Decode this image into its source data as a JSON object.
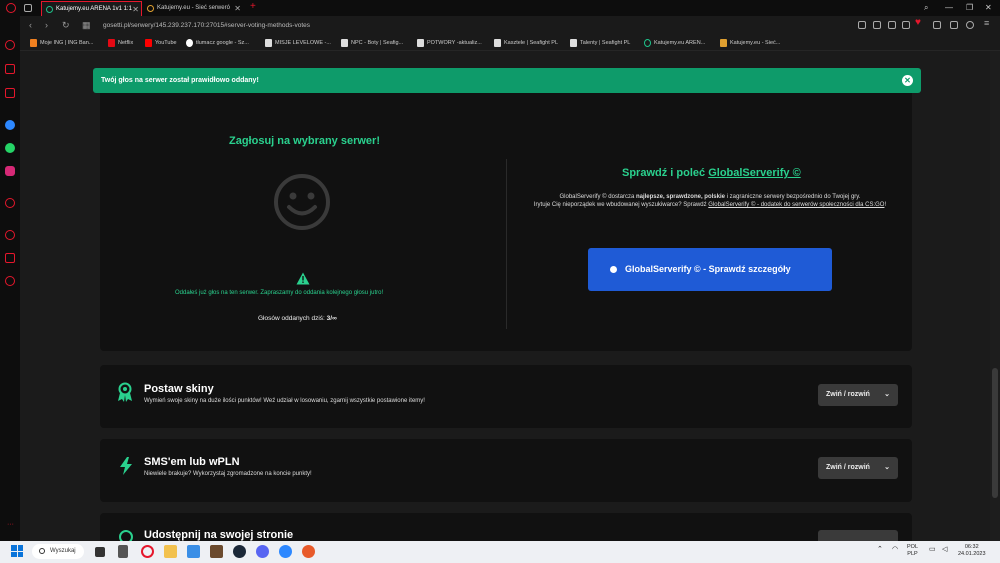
{
  "browser": {
    "tabs": [
      {
        "label": "Katujemy.eu ARENA 1v1 1:1",
        "active": true
      },
      {
        "label": "Katujemy.eu - Sieć serweró",
        "active": false
      }
    ],
    "url": "gosetti.pl/serwery/145.239.237.170:27015#server-voting-methods-votes",
    "bookmarks": [
      "Moje ING | ING Ban...",
      "Netflix",
      "YouTube",
      "tłumacz google - Sz...",
      "MISJE LEVELOWE -...",
      "NPC - Boty | Seafig...",
      "POTWORY -aktualiz...",
      "Kasztele | Seafight PL",
      "Talenty | Seafight PL",
      "Katujemy.eu AREN...",
      "Katujemy.eu - Sieć..."
    ]
  },
  "alert": {
    "message": "Twój głos na serwer został prawidłowo oddany!",
    "close_icon": "close-icon",
    "color": "#0e9b6a"
  },
  "vote_card": {
    "title": "Zagłosuj na wybrany serwer!",
    "smiley_icon": "smiley-icon",
    "warning_icon": "warning-icon",
    "voted_message": "Oddałeś już głos na ten serwer. Zapraszamy do oddania kolejnego głosu jutro!",
    "votes_label": "Głosów oddanych dziś:",
    "votes_value": "3/∞",
    "gs_title_prefix": "Sprawdź i poleć",
    "gs_title_link": "GlobalServerify ©",
    "gs_desc_1": "GlobalServerify © dostarcza ",
    "gs_desc_bold": "najlepsze, sprawdzone, polskie",
    "gs_desc_2": " i zagraniczne serwery bezpośrednio do Twojej gry.",
    "gs_desc_3": "Irytuje Cię nieporządek we wbudowanej wyszukiwarce? Sprawdź ",
    "gs_desc_link": "GlobalServerify © - dodatek do serwerów społeczności dla CS:GO",
    "gs_desc_end": "!",
    "gs_button": "GlobalServerify © - Sprawdź szczegóły",
    "accent": "#2ad18e",
    "button_color": "#1f5bd6"
  },
  "sections": [
    {
      "title": "Postaw skiny",
      "desc": "Wymień swoje skiny na duże ilości punktów! Weź udział w losowaniu, zgarnij wszystkie postawione itemy!",
      "icon": "award-icon",
      "button": "Zwiń / rozwiń"
    },
    {
      "title": "SMS'em lub wPLN",
      "desc": "Niewiele brakuje? Wykorzystaj zgromadzone na koncie punkty!",
      "icon": "lightning-icon",
      "button": "Zwiń / rozwiń"
    },
    {
      "title": "Udostępnij na swojej stronie",
      "icon": "share-icon",
      "button": ""
    }
  ],
  "taskbar": {
    "search": "Wyszukaj",
    "lang1": "POL",
    "lang2": "PLP",
    "time": "06:32",
    "date": "24.01.2023"
  }
}
